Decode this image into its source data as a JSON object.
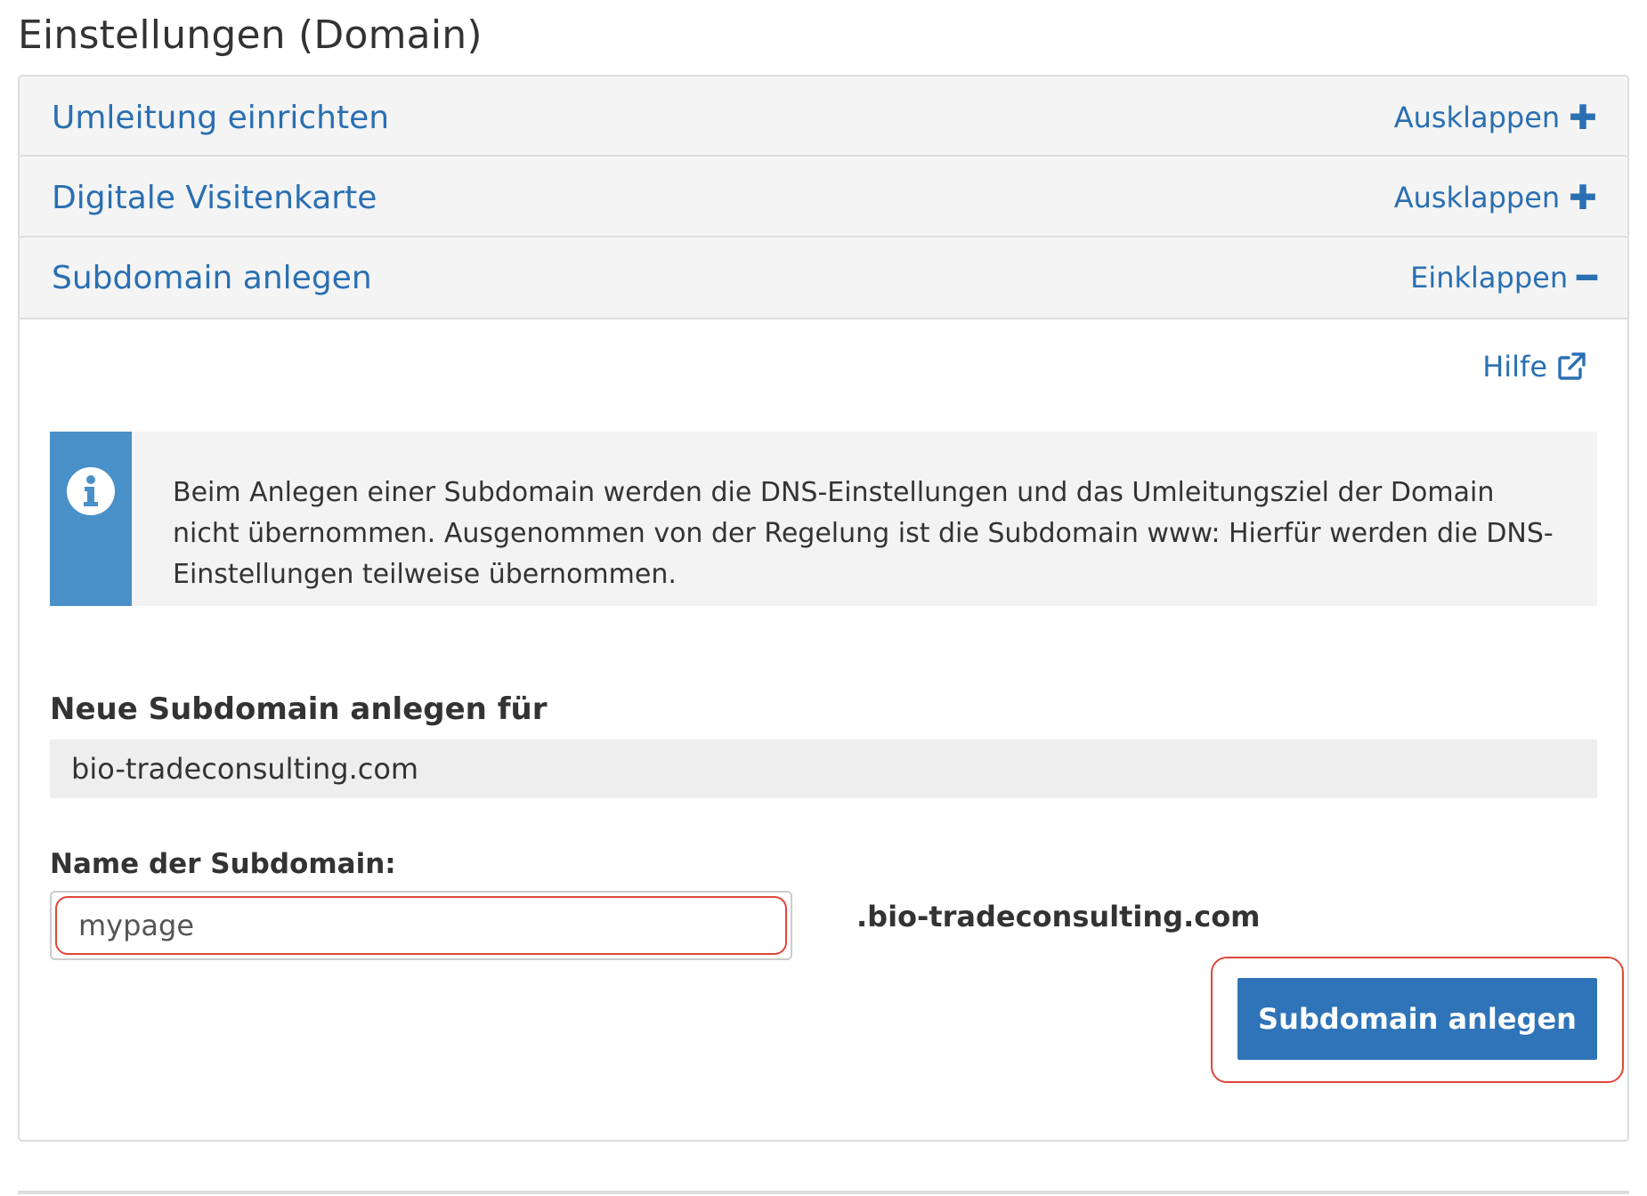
{
  "page": {
    "title": "Einstellungen (Domain)"
  },
  "panels": {
    "redirect": {
      "title": "Umleitung einrichten",
      "toggle_label": "Ausklappen",
      "toggle_icon": "plus-icon"
    },
    "vcard": {
      "title": "Digitale Visitenkarte",
      "toggle_label": "Ausklappen",
      "toggle_icon": "plus-icon"
    },
    "subdomain": {
      "title": "Subdomain anlegen",
      "toggle_label": "Einklappen",
      "toggle_icon": "minus-icon"
    }
  },
  "subdomain_form": {
    "help_label": "Hilfe",
    "help_icon": "external-link-icon",
    "info_icon": "info-icon",
    "info_text": "Beim Anlegen einer Subdomain werden die DNS-Einstellungen und das Umleitungsziel der Domain nicht übernommen. Ausgenommen von der Regelung ist die Subdomain www: Hierfür werden die DNS-Einstellungen teilweise übernommen.",
    "new_subdomain_label": "Neue Subdomain anlegen für",
    "parent_domain": "bio-tradeconsulting.com",
    "name_label": "Name der Subdomain:",
    "name_value": "mypage",
    "domain_suffix": ".bio-tradeconsulting.com",
    "submit_label": "Subdomain anlegen"
  },
  "colors": {
    "link_blue": "#2a6fb2",
    "info_stripe": "#4a90c8",
    "button_blue": "#2f74b8",
    "highlight_red": "#e0473a"
  }
}
